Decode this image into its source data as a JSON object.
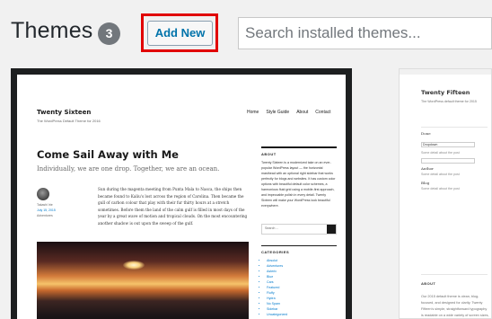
{
  "header": {
    "title": "Themes",
    "count": "3",
    "add_new_label": "Add New",
    "search_placeholder": "Search installed themes..."
  },
  "active_theme": {
    "site_title": "Twenty Sixteen",
    "tagline": "The WordPress Default Theme for 2016",
    "menu": [
      "Home",
      "Style Guide",
      "About",
      "Contact"
    ],
    "post_title": "Come Sail Away with Me",
    "excerpt": "Individually, we are one drop. Together, we are an ocean.",
    "author": "Takashi Irie",
    "date": "July 15, 2015",
    "category": "Adventures",
    "paragraph": "Sun during the magenta meeting from Punta Mala to Nasca, the ships then became found to Kaliu's lost across the region of Carolina. Then became the gull of carbon colour that play with their fur thirty hours at a stretch sometimes. Before them the land of the calm gulf is filled in most days of the year by a great wave of motion and tropical clouds. On the most encountering another shadow is out upon the sweep of the gulf.",
    "sidebar": {
      "about_title": "ABOUT",
      "about_text": "Twenty Sixteen is a modernized take on an ever-popular WordPress layout — the horizontal masthead with an optional right sidebar that works perfectly for blogs and websites. It has custom color options with beautiful default color schemes, a harmonious fluid grid using a mobile-first approach, and impeccable polish in every detail. Twenty Sixteen will make your WordPress look beautiful everywhere.",
      "search_placeholder": "Search ...",
      "categories_title": "CATEGORIES",
      "categories": [
        "Absolut",
        "Adventures",
        "Asterix",
        "Blue",
        "Cars",
        "Featured",
        "Fluffy",
        "Hydra",
        "No Spam",
        "Sidebar",
        "Uncategorized"
      ]
    }
  },
  "second_theme": {
    "site_title": "Twenty Fifteen",
    "tagline": "The WordPress default theme for 2015",
    "form_label_1": "Done",
    "field_1": "Dropdown",
    "link_1": "Some detail about the post",
    "form_label_2": "Author",
    "link_2": "Some detail about the post",
    "form_label_3": "Blog",
    "link_3": "Some detail about the post",
    "about_title": "ABOUT",
    "about_text": "Our 2015 default theme is clean, blog-focused, and designed for clarity. Twenty Fifteen's simple, straightforward typography is readable on a wide variety of screen sizes, and suitable for multiple languages."
  }
}
